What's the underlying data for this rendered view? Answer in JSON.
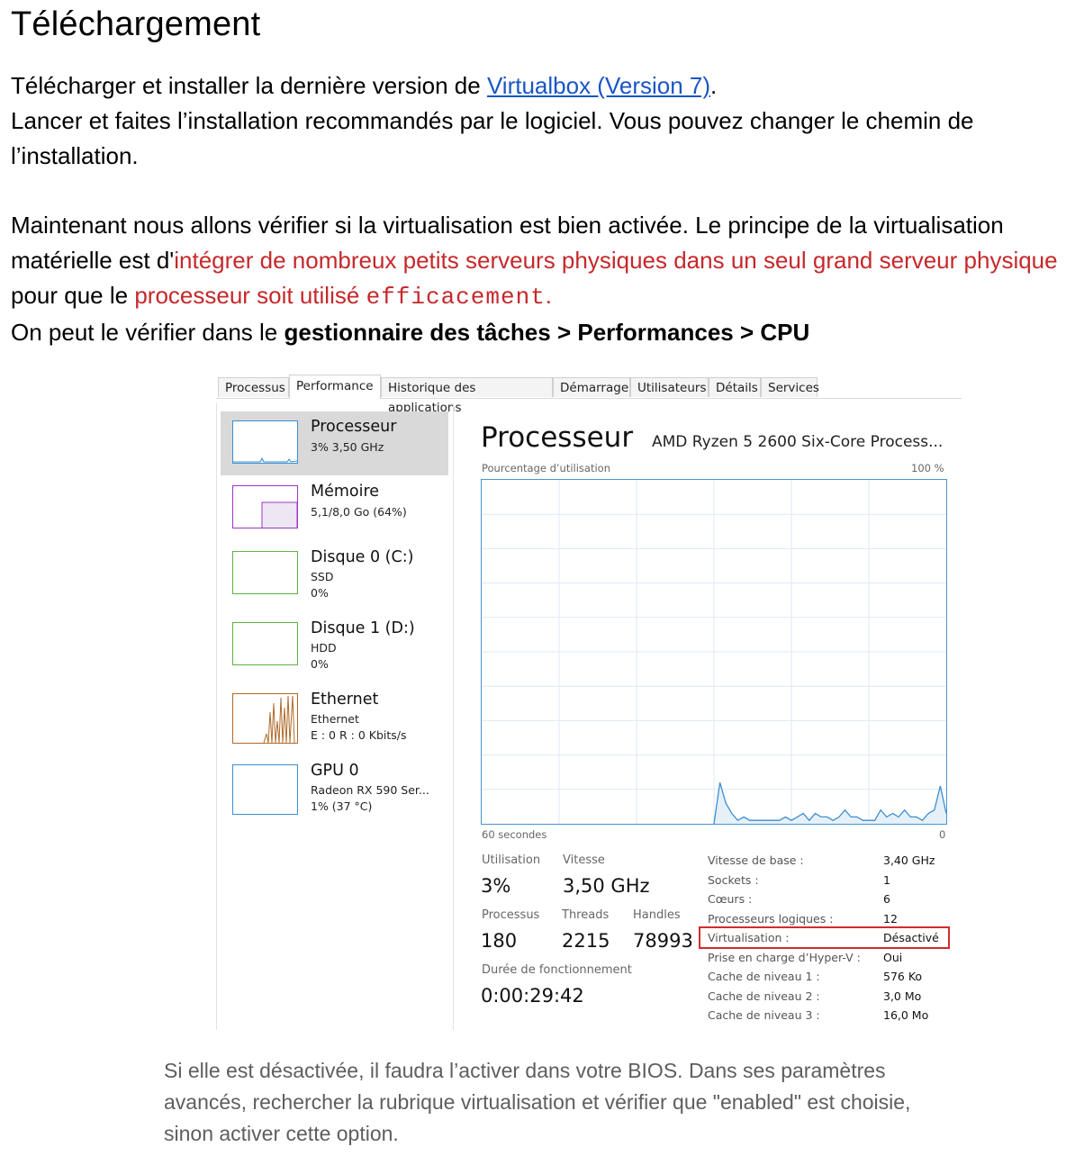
{
  "heading": "Téléchargement",
  "intro": {
    "line1_before": "Télécharger et installer la dernière version de ",
    "link": "Virtualbox (Version 7)",
    "line1_after": ".",
    "line2": "Lancer et faites l’installation recommandés par le logiciel. Vous pouvez changer le chemin de l’installation."
  },
  "virt": {
    "part1": "Maintenant nous allons vérifier si la virtualisation est bien activée. Le principe de la virtualisation matérielle est d'",
    "red1": "intégrer de nombreux petits serveurs physiques dans un seul grand serveur physique",
    "part2": " pour que le ",
    "red2": "processeur soit utilisé ",
    "red_mono": "efficacement",
    "red3": ".",
    "check_before": "On peut le vérifier dans le ",
    "check_bold": "gestionnaire des tâches > Performances > CPU"
  },
  "taskmgr": {
    "tabs": [
      "Processus",
      "Performance",
      "Historique des applications",
      "Démarrage",
      "Utilisateurs",
      "Détails",
      "Services"
    ],
    "active_tab": "Performance",
    "items": [
      {
        "name": "Processeur",
        "sub1": "3% 3,50 GHz",
        "sub2": "",
        "color": "#3c8fd0"
      },
      {
        "name": "Mémoire",
        "sub1": "5,1/8,0 Go (64%)",
        "sub2": "",
        "color": "#9b35c4"
      },
      {
        "name": "Disque 0 (C:)",
        "sub1": "SSD",
        "sub2": "0%",
        "color": "#5cb33e"
      },
      {
        "name": "Disque 1 (D:)",
        "sub1": "HDD",
        "sub2": "0%",
        "color": "#5cb33e"
      },
      {
        "name": "Ethernet",
        "sub1": "Ethernet",
        "sub2": "E : 0 R : 0 Kbits/s",
        "color": "#b06a2a"
      },
      {
        "name": "GPU 0",
        "sub1": "Radeon RX 590 Ser...",
        "sub2": "1% (37 °C)",
        "color": "#3c8fd0"
      }
    ],
    "title": "Processeur",
    "model": "AMD Ryzen 5 2600 Six-Core Process...",
    "graph_label": "Pourcentage d’utilisation",
    "graph_max": "100 %",
    "graph_time": "60 secondes",
    "graph_min": "0",
    "stats": {
      "utilisation_label": "Utilisation",
      "utilisation": "3%",
      "vitesse_label": "Vitesse",
      "vitesse": "3,50 GHz",
      "processus_label": "Processus",
      "processus": "180",
      "threads_label": "Threads",
      "threads": "2215",
      "handles_label": "Handles",
      "handles": "78993",
      "uptime_label": "Durée de fonctionnement",
      "uptime": "0:00:29:42"
    },
    "details": [
      {
        "k": "Vitesse de base :",
        "v": "3,40 GHz"
      },
      {
        "k": "Sockets :",
        "v": "1"
      },
      {
        "k": "Cœurs :",
        "v": "6"
      },
      {
        "k": "Processeurs logiques :",
        "v": "12"
      },
      {
        "k": "Virtualisation :",
        "v": "Désactivé"
      },
      {
        "k": "Prise en charge d’Hyper-V :",
        "v": "Oui"
      },
      {
        "k": "Cache de niveau 1 :",
        "v": "576 Ko"
      },
      {
        "k": "Cache de niveau 2 :",
        "v": "3,0 Mo"
      },
      {
        "k": "Cache de niveau 3 :",
        "v": "16,0 Mo"
      }
    ],
    "cpu_usage_series": [
      0,
      0,
      0,
      0,
      0,
      0,
      0,
      0,
      0,
      0,
      0,
      0,
      0,
      0,
      0,
      0,
      0,
      0,
      0,
      0,
      0,
      0,
      0,
      0,
      0,
      0,
      0,
      0,
      0,
      0,
      0,
      0,
      0,
      0,
      0,
      0,
      0,
      0,
      0,
      0,
      12,
      6,
      3,
      1,
      2,
      1,
      1,
      1,
      1,
      1,
      1,
      2,
      1,
      2,
      3,
      1,
      3,
      2,
      2,
      1,
      2,
      4,
      2,
      2,
      1,
      1,
      1,
      4,
      2,
      3,
      2,
      4,
      2,
      2,
      1,
      3,
      4,
      11,
      3
    ]
  },
  "note": "Si elle est désactivée, il faudra l’activer dans votre BIOS. Dans ses paramètres avancés, rechercher la rubrique virtualisation et vérifier que \"enabled\" est choisie, sinon activer cette option."
}
